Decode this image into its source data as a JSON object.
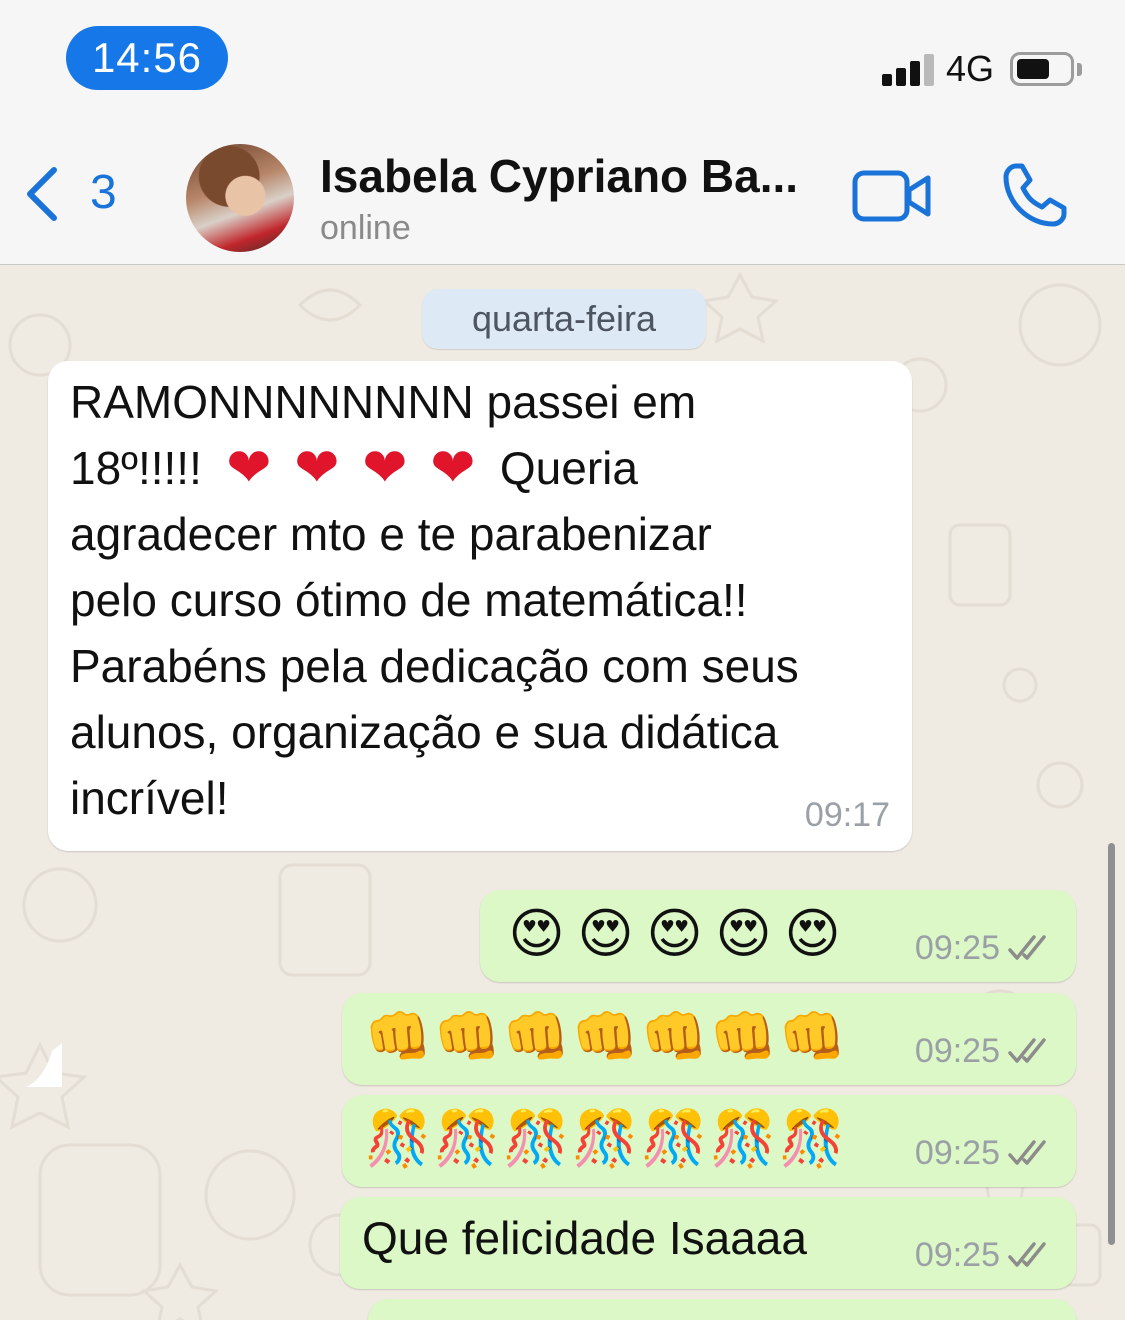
{
  "status_bar": {
    "time": "14:56",
    "network": "4G",
    "signal_bars": 3,
    "battery_level": 0.6
  },
  "header": {
    "back_count": "3",
    "contact_name": "Isabela Cypriano Ba...",
    "contact_status": "online",
    "icons": [
      "chevron-left-icon",
      "video-camera-icon",
      "phone-icon"
    ]
  },
  "chat": {
    "date_separator": "quarta-feira",
    "messages": [
      {
        "direction": "incoming",
        "line1": "RAMONNNNNNNN passei em",
        "line2_text": "18º!!!!!",
        "line2_hearts": [
          "❤",
          "❤",
          "❤",
          "❤"
        ],
        "line2_tail": "Queria",
        "line3": "agradecer mto e te parabenizar",
        "line4": "pelo curso ótimo de matemática!!",
        "line5": "Parabéns pela dedicação com seus",
        "line6": "alunos, organização e sua didática",
        "line7": "incrível!",
        "time": "09:17"
      },
      {
        "direction": "outgoing",
        "emoji": [
          "😍",
          "😍",
          "😍",
          "😍",
          "😍"
        ],
        "time": "09:25",
        "status": "read"
      },
      {
        "direction": "outgoing",
        "emoji": [
          "👊",
          "👊",
          "👊",
          "👊",
          "👊",
          "👊",
          "👊"
        ],
        "time": "09:25",
        "status": "read"
      },
      {
        "direction": "outgoing",
        "emoji": [
          "🎊",
          "🎊",
          "🎊",
          "🎊",
          "🎊",
          "🎊",
          "🎊"
        ],
        "time": "09:25",
        "status": "read"
      },
      {
        "direction": "outgoing",
        "text": "Que felicidade Isaaaa",
        "time": "09:25",
        "status": "read"
      }
    ]
  },
  "colors": {
    "accent": "#1a73d9",
    "time_pill": "#1577e8",
    "incoming_bubble": "#ffffff",
    "outgoing_bubble": "#dcf8c6",
    "chat_background": "#efeae2",
    "read_ticks": "#8c8c8c"
  }
}
